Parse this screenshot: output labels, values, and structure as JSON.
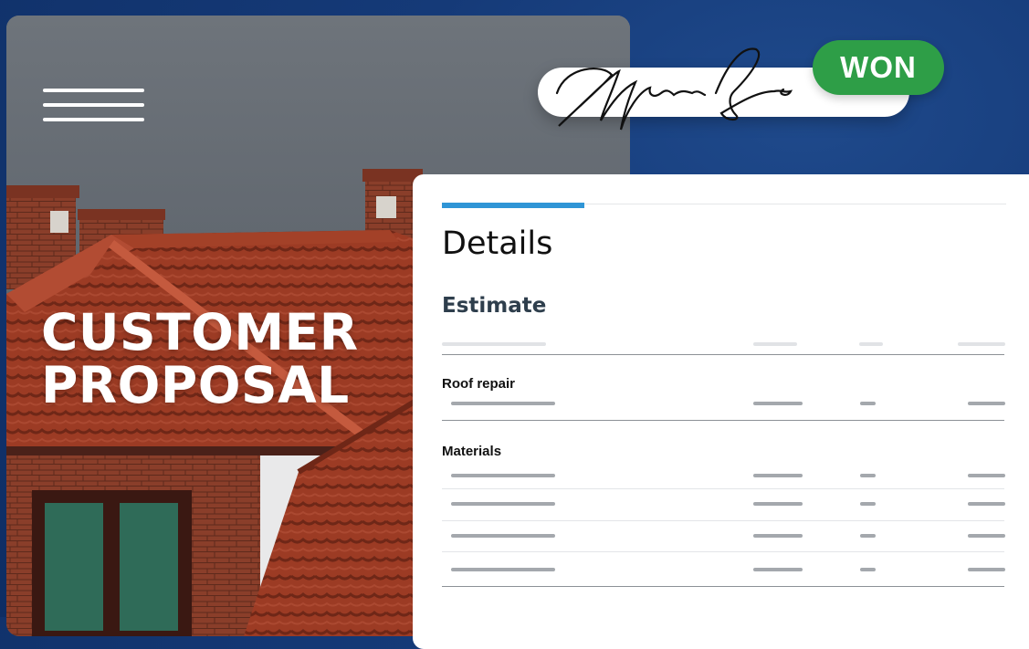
{
  "cover": {
    "title_line1": "CUSTOMER",
    "title_line2": "PROPOSAL",
    "menu_icon": "hamburger-menu-icon",
    "image": "red-tile-roof-photo"
  },
  "signature": {
    "status_badge": "WON",
    "badge_color": "#2e9e47"
  },
  "details_panel": {
    "heading": "Details",
    "subheading": "Estimate",
    "accent_color": "#2f95d6",
    "sections": [
      {
        "label": "Roof repair",
        "line_items": 1
      },
      {
        "label": "Materials",
        "line_items": 4
      }
    ]
  }
}
